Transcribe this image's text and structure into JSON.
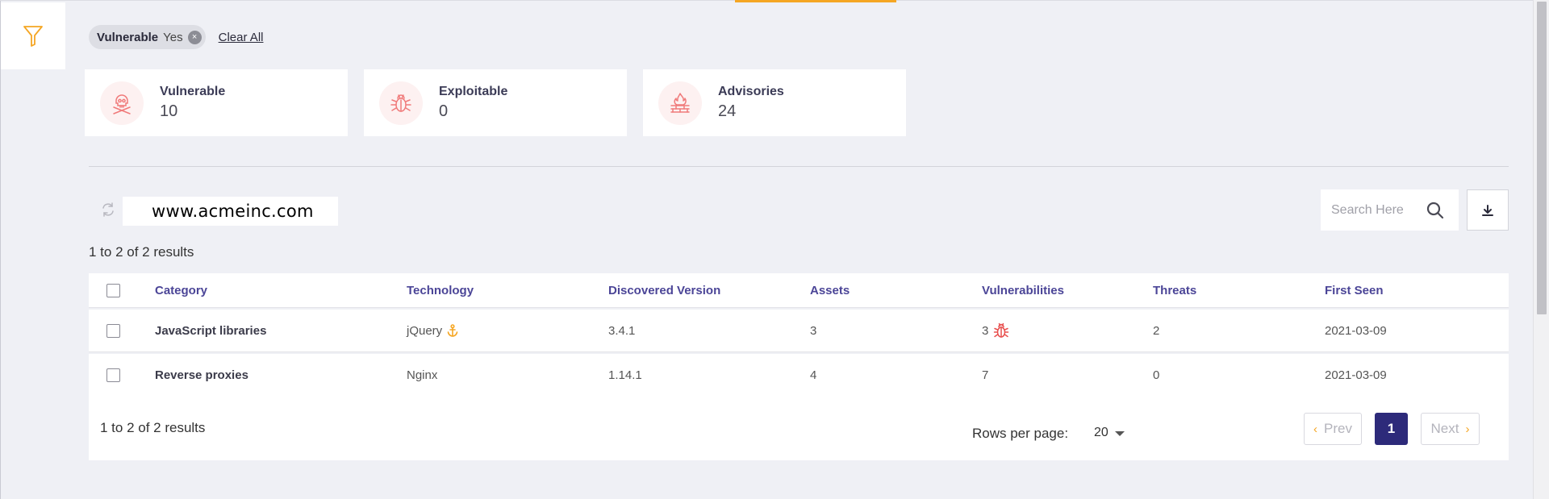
{
  "filters": {
    "chips": [
      {
        "key": "Vulnerable",
        "value": "Yes",
        "close_glyph": "×"
      }
    ],
    "clear_all": "Clear All"
  },
  "cards": [
    {
      "label": "Vulnerable",
      "value": "10",
      "icon": "skull-crossbones-icon"
    },
    {
      "label": "Exploitable",
      "value": "0",
      "icon": "bug-icon"
    },
    {
      "label": "Advisories",
      "value": "24",
      "icon": "firewall-icon"
    }
  ],
  "domain": "www.acmeinc.com",
  "search": {
    "placeholder": "Search Here"
  },
  "results_summary_top": "1 to 2 of 2  results",
  "table": {
    "columns": [
      "Category",
      "Technology",
      "Discovered Version",
      "Assets",
      "Vulnerabilities",
      "Threats",
      "First Seen"
    ],
    "rows": [
      {
        "category": "JavaScript libraries",
        "technology": "jQuery",
        "technology_icon": "anchor-icon",
        "version": "3.4.1",
        "assets": "3",
        "vulnerabilities": "3",
        "vuln_icon": "bug-icon",
        "threats": "2",
        "first_seen": "2021-03-09"
      },
      {
        "category": "Reverse proxies",
        "technology": "Nginx",
        "version": "1.14.1",
        "assets": "4",
        "vulnerabilities": "7",
        "threats": "0",
        "first_seen": "2021-03-09"
      }
    ]
  },
  "pagination": {
    "results_summary": "1 to 2 of 2  results",
    "rows_per_page_label": "Rows per page:",
    "rows_per_page_value": "20",
    "prev": "Prev",
    "next": "Next",
    "current_page": "1",
    "prev_glyph": "‹",
    "next_glyph": "›"
  },
  "colors": {
    "accent": "#f5a623",
    "header_text": "#4b4597",
    "current_page": "#2d2a7a",
    "card_icon": "#f07a7a"
  }
}
